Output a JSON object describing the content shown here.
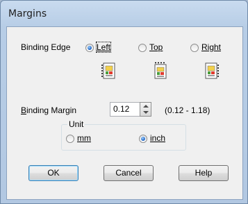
{
  "window": {
    "title": "Margins"
  },
  "binding_edge": {
    "label": "Binding Edge",
    "options": [
      {
        "label": "Left",
        "selected": true
      },
      {
        "label": "Top",
        "selected": false
      },
      {
        "label": "Right",
        "selected": false
      }
    ],
    "icons": [
      "binding-left-icon",
      "binding-top-icon",
      "binding-right-icon"
    ]
  },
  "binding_margin": {
    "label": "Binding Margin",
    "value": "0.12",
    "range": "(0.12 - 1.18)"
  },
  "unit": {
    "title": "Unit",
    "options": [
      {
        "label": "mm",
        "selected": false
      },
      {
        "label": "inch",
        "selected": true
      }
    ]
  },
  "buttons": {
    "ok": "OK",
    "cancel": "Cancel",
    "help": "Help"
  }
}
